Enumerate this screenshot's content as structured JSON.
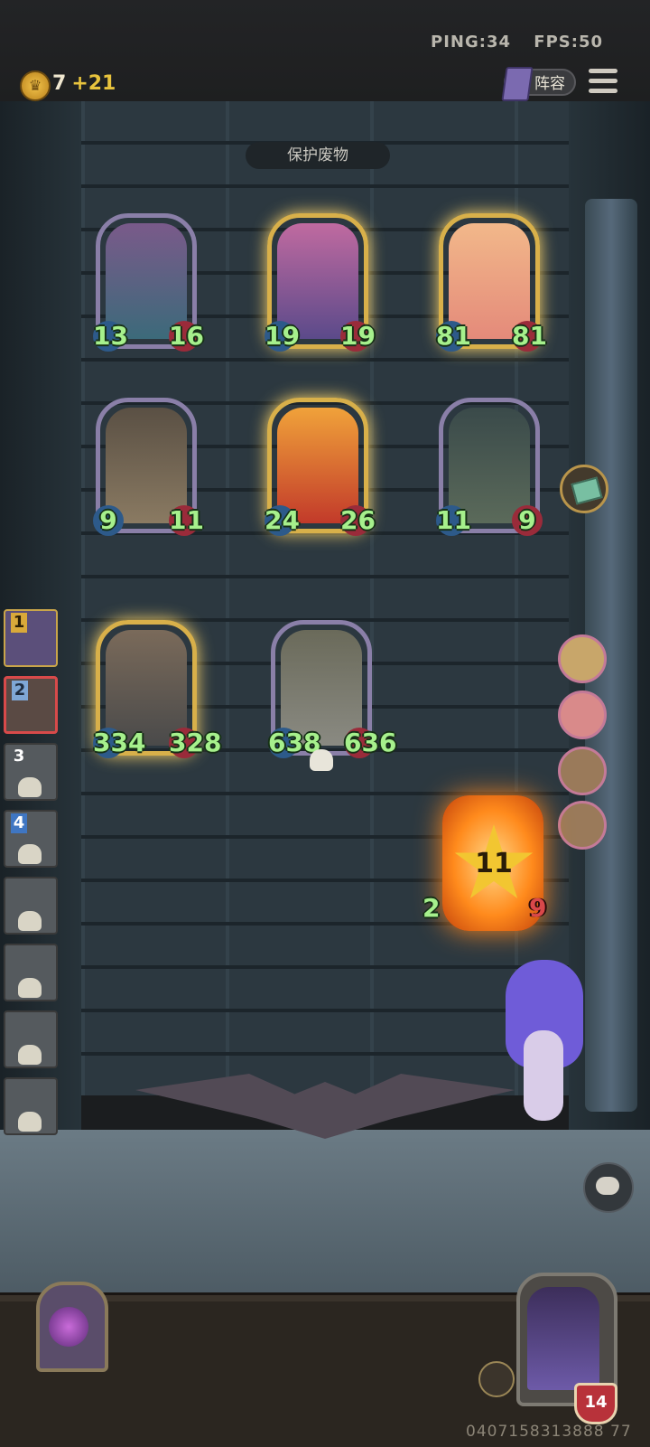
{
  "network": {
    "ping": "PING:34",
    "fps": "FPS:50"
  },
  "gold": {
    "amount": "7",
    "income": "+21"
  },
  "buttons": {
    "lineup": "阵容"
  },
  "board_title": "保护废物",
  "board_cards": [
    {
      "attack": "13",
      "health": "16",
      "style": "purple"
    },
    {
      "attack": "19",
      "health": "19",
      "style": "gold"
    },
    {
      "attack": "81",
      "health": "81",
      "style": "gold"
    },
    {
      "attack": "9",
      "health": "11",
      "style": "purple"
    },
    {
      "attack": "24",
      "health": "26",
      "style": "gold"
    },
    {
      "attack": "11",
      "health": "9",
      "style": "purple"
    },
    {
      "attack": "334",
      "health": "328",
      "style": "gold"
    },
    {
      "attack": "638",
      "health": "636",
      "style": "purple"
    }
  ],
  "left_list": [
    {
      "rank": "1"
    },
    {
      "rank": "2"
    },
    {
      "rank": "3"
    },
    {
      "rank": "4"
    }
  ],
  "enemy": {
    "tier": "11",
    "attack": "2",
    "health": "9"
  },
  "player": {
    "health": "14",
    "uid": "0407158313888 77"
  }
}
